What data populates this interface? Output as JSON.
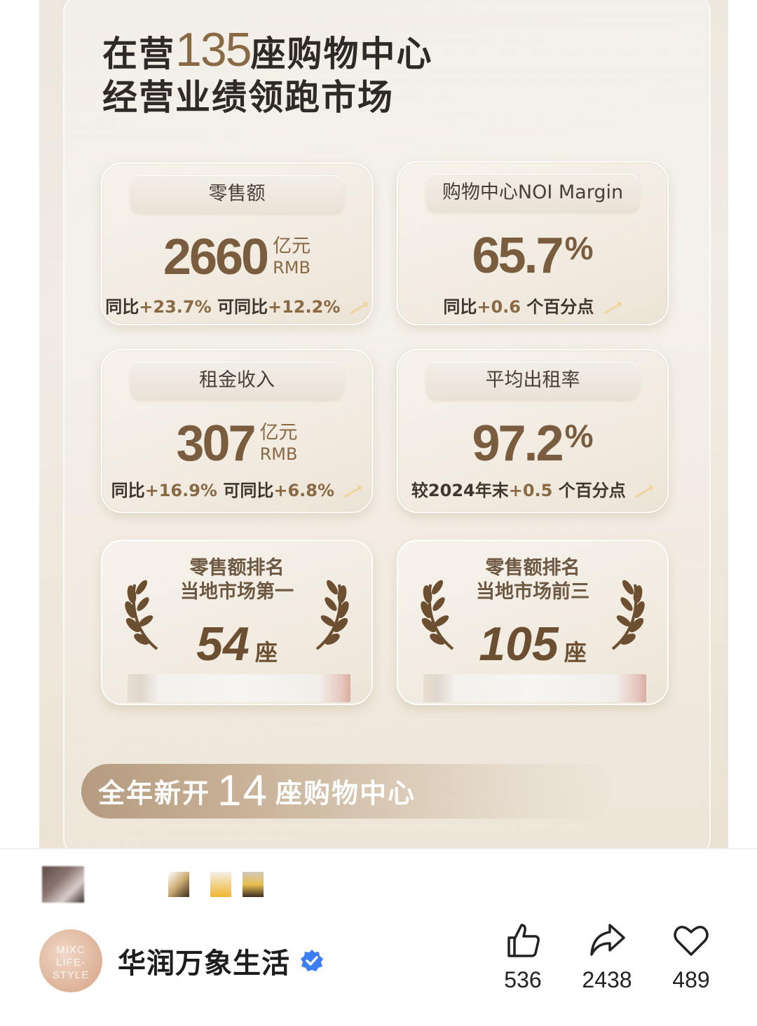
{
  "poster": {
    "headline_line1_prefix": "在营",
    "headline_line1_num": "135",
    "headline_line1_suffix": "座购物中心",
    "headline_line2": "经营业绩领跑市场",
    "cards": [
      {
        "label": "零售额",
        "value": "2660",
        "unit_cn": "亿元",
        "unit_en": "RMB",
        "foot_a": "同比",
        "foot_b": "+23.7%",
        "foot_c": " 可同比",
        "foot_d": "+12.2%"
      },
      {
        "label": "购物中心NOI Margin",
        "value": "65.7",
        "pct": "%",
        "foot_a": "同比",
        "foot_b": "+0.6",
        "foot_c": " 个百分点",
        "foot_d": ""
      },
      {
        "label": "租金收入",
        "value": "307",
        "unit_cn": "亿元",
        "unit_en": "RMB",
        "foot_a": "同比",
        "foot_b": "+16.9%",
        "foot_c": " 可同比",
        "foot_d": "+6.8%"
      },
      {
        "label": "平均出租率",
        "value": "97.2",
        "pct": "%",
        "foot_a": "较2024年末",
        "foot_b": "+0.5",
        "foot_c": " 个百分点",
        "foot_d": ""
      }
    ],
    "awards": [
      {
        "title1": "零售额排名",
        "title2": "当地市场第一",
        "value": "54",
        "unit": "座"
      },
      {
        "title1": "零售额排名",
        "title2": "当地市场前三",
        "value": "105",
        "unit": "座"
      }
    ],
    "banner": {
      "prefix": "全年新开",
      "num": "14",
      "suffix": "座购物中心"
    }
  },
  "account": {
    "logo_lines": [
      "MIXC",
      "LIFE-",
      "STYLE"
    ],
    "name": "华润万象生活"
  },
  "actions": {
    "like_count": "536",
    "share_count": "2438",
    "favorite_count": "489"
  },
  "colors": {
    "accent": "#8a6a45",
    "verified": "#3d7ff2"
  }
}
